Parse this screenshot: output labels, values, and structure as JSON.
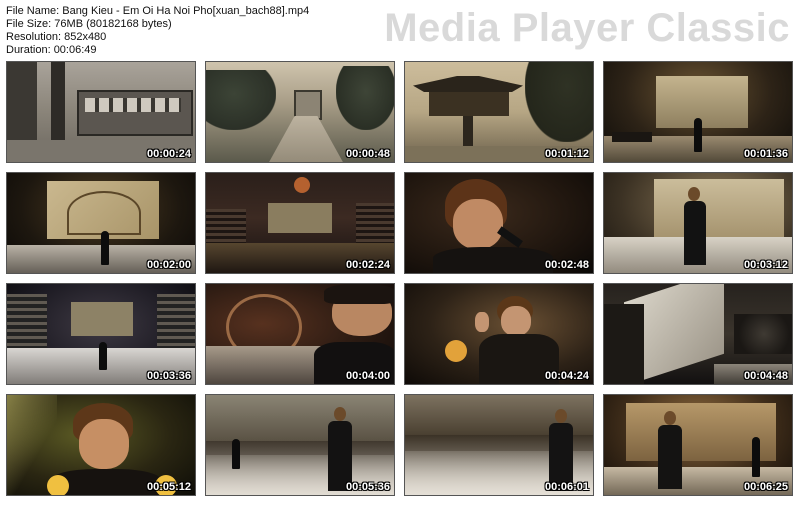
{
  "file_info": {
    "name_line": "File Name: Bang Kieu - Em Oi Ha Noi Pho[xuan_bach88].mp4",
    "size_line": "File Size: 76MB (80182168 bytes)",
    "resolution_line": "Resolution: 852x480",
    "duration_line": "Duration: 00:06:49"
  },
  "brand": "Media Player Classic",
  "thumbnails": [
    {
      "time": "00:00:24",
      "scene": "tram-street"
    },
    {
      "time": "00:00:48",
      "scene": "bridge-gate"
    },
    {
      "time": "00:01:12",
      "scene": "one-pillar-pagoda"
    },
    {
      "time": "00:01:36",
      "scene": "stage-wide"
    },
    {
      "time": "00:02:00",
      "scene": "stage-tree-screen"
    },
    {
      "time": "00:02:24",
      "scene": "concert-hall"
    },
    {
      "time": "00:02:48",
      "scene": "singer-closeup"
    },
    {
      "time": "00:03:12",
      "scene": "singer-stage-screen"
    },
    {
      "time": "00:03:36",
      "scene": "stage-lights"
    },
    {
      "time": "00:04:00",
      "scene": "flute-player"
    },
    {
      "time": "00:04:24",
      "scene": "singer-hand-raised"
    },
    {
      "time": "00:04:48",
      "scene": "screen-angle"
    },
    {
      "time": "00:05:12",
      "scene": "singer-closeup-lights"
    },
    {
      "time": "00:05:36",
      "scene": "singer-fog"
    },
    {
      "time": "00:06:01",
      "scene": "singer-fog-2"
    },
    {
      "time": "00:06:25",
      "scene": "singer-warm-stage"
    }
  ]
}
